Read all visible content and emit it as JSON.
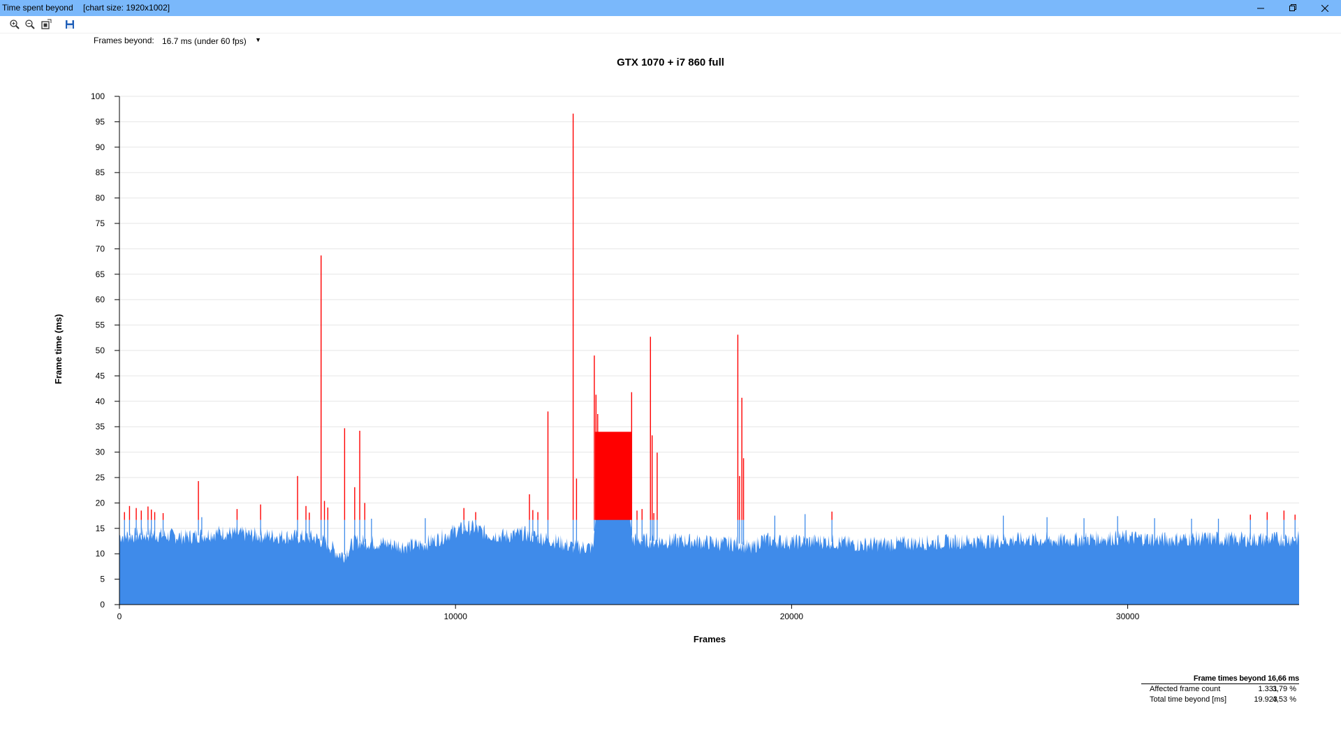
{
  "window": {
    "title": "Time spent beyond",
    "chart_size": "[chart size: 1920x1002]"
  },
  "toolbar": {
    "icons": [
      "zoom-in-icon",
      "zoom-out-icon",
      "fit-window-icon",
      "save-icon"
    ],
    "frames_beyond_label": "Frames beyond:",
    "frames_beyond_value": "16.7 ms (under 60 fps)"
  },
  "colors": {
    "titlebar": "#7ab8fb",
    "normal": "#3f8bea",
    "beyond": "#ff0000",
    "grid": "#e6e6e6"
  },
  "chart_data": {
    "type": "bar",
    "title": "GTX 1070 + i7 860 full",
    "xlabel": "Frames",
    "ylabel": "Frame time (ms)",
    "xlim": [
      0,
      35100
    ],
    "ylim": [
      0,
      100
    ],
    "xticks": [
      0,
      10000,
      20000,
      30000
    ],
    "yticks": [
      0,
      5,
      10,
      15,
      20,
      25,
      30,
      35,
      40,
      45,
      50,
      55,
      60,
      65,
      70,
      75,
      80,
      85,
      90,
      95,
      100
    ],
    "threshold": 16.66,
    "grid": true,
    "baseline": [
      [
        0,
        13.5
      ],
      [
        1000,
        13.8
      ],
      [
        2000,
        13.3
      ],
      [
        3000,
        14.2
      ],
      [
        4000,
        13.7
      ],
      [
        5000,
        13.4
      ],
      [
        5800,
        13.2
      ],
      [
        6200,
        12.0
      ],
      [
        6500,
        10.0
      ],
      [
        6700,
        9.8
      ],
      [
        7000,
        12.5
      ],
      [
        7500,
        12.2
      ],
      [
        8000,
        12.0
      ],
      [
        8500,
        11.5
      ],
      [
        9000,
        11.8
      ],
      [
        9500,
        13.0
      ],
      [
        10000,
        14.6
      ],
      [
        10500,
        15.2
      ],
      [
        11000,
        13.8
      ],
      [
        11500,
        13.5
      ],
      [
        12000,
        14.0
      ],
      [
        12500,
        13.2
      ],
      [
        13000,
        12.5
      ],
      [
        13400,
        11.5
      ],
      [
        14100,
        11.2
      ],
      [
        14150,
        16.7
      ],
      [
        15200,
        16.7
      ],
      [
        15250,
        12.8
      ],
      [
        16000,
        12.5
      ],
      [
        17000,
        12.5
      ],
      [
        18000,
        12.0
      ],
      [
        18500,
        12.0
      ],
      [
        18800,
        10.8
      ],
      [
        19100,
        12.8
      ],
      [
        20000,
        12.3
      ],
      [
        21000,
        12.5
      ],
      [
        22000,
        11.8
      ],
      [
        23000,
        12.0
      ],
      [
        24000,
        12.2
      ],
      [
        25000,
        12.4
      ],
      [
        26000,
        12.6
      ],
      [
        27000,
        12.8
      ],
      [
        28000,
        12.6
      ],
      [
        29000,
        13.0
      ],
      [
        30000,
        13.2
      ],
      [
        31000,
        12.8
      ],
      [
        32000,
        13.0
      ],
      [
        33000,
        12.9
      ],
      [
        34000,
        12.8
      ],
      [
        35000,
        13.0
      ]
    ],
    "noise": 1.6,
    "beyond_block": {
      "x_start": 14150,
      "x_end": 15230,
      "value": 34
    },
    "spikes": [
      [
        150,
        18.2
      ],
      [
        300,
        19.4
      ],
      [
        500,
        19.0
      ],
      [
        650,
        18.5
      ],
      [
        850,
        19.3
      ],
      [
        950,
        18.7
      ],
      [
        1050,
        18.2
      ],
      [
        1300,
        18.0
      ],
      [
        2350,
        24.3
      ],
      [
        3500,
        18.8
      ],
      [
        4200,
        19.7
      ],
      [
        5300,
        25.3
      ],
      [
        5550,
        19.4
      ],
      [
        5650,
        18.1
      ],
      [
        6000,
        68.7
      ],
      [
        6100,
        20.4
      ],
      [
        6200,
        19.1
      ],
      [
        6700,
        34.7
      ],
      [
        7000,
        23.1
      ],
      [
        7150,
        34.2
      ],
      [
        7300,
        20.0
      ],
      [
        10250,
        19.0
      ],
      [
        10600,
        18.2
      ],
      [
        12200,
        21.7
      ],
      [
        12300,
        18.6
      ],
      [
        12450,
        18.2
      ],
      [
        12750,
        38.0
      ],
      [
        13500,
        96.6
      ],
      [
        13600,
        24.8
      ],
      [
        14130,
        49.0
      ],
      [
        14180,
        41.3
      ],
      [
        14230,
        37.5
      ],
      [
        15240,
        41.8
      ],
      [
        15400,
        18.5
      ],
      [
        15550,
        18.8
      ],
      [
        15800,
        52.7
      ],
      [
        15850,
        33.3
      ],
      [
        15900,
        18.0
      ],
      [
        16000,
        29.9
      ],
      [
        18400,
        53.1
      ],
      [
        18450,
        25.3
      ],
      [
        18520,
        40.7
      ],
      [
        18570,
        28.8
      ],
      [
        21200,
        18.3
      ],
      [
        33650,
        17.7
      ],
      [
        34150,
        18.2
      ],
      [
        34650,
        18.5
      ],
      [
        34980,
        17.7
      ]
    ],
    "blue_peaks": [
      [
        2450,
        17.2
      ],
      [
        7500,
        16.9
      ],
      [
        9100,
        17.0
      ],
      [
        19500,
        17.5
      ],
      [
        20400,
        17.8
      ],
      [
        26300,
        17.5
      ],
      [
        27600,
        17.2
      ],
      [
        28700,
        17.0
      ],
      [
        29700,
        17.4
      ],
      [
        30800,
        17.0
      ],
      [
        31900,
        16.9
      ],
      [
        32700,
        16.9
      ]
    ]
  },
  "stats": {
    "header": "Frame times beyond 16,66 ms",
    "rows": [
      {
        "label": "Affected frame count",
        "value": "1.331",
        "pct": "3,79 %"
      },
      {
        "label": "Total time beyond [ms]",
        "value": "19.923",
        "pct": "4,53 %"
      }
    ]
  }
}
